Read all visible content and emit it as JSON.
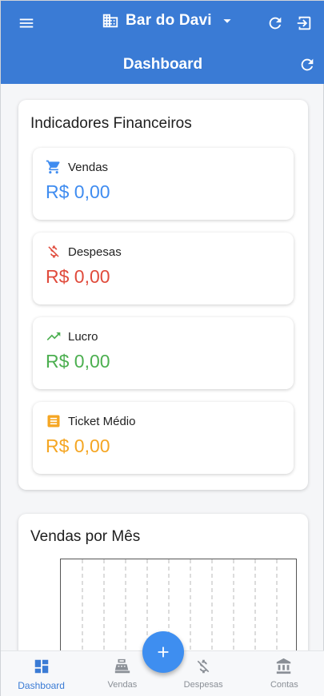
{
  "header": {
    "store_name": "Bar do Davi",
    "title": "Dashboard"
  },
  "indicators": {
    "title": "Indicadores Financeiros",
    "items": [
      {
        "label": "Vendas",
        "value": "R$ 0,00",
        "color": "#3f8cf0",
        "icon": "cart-icon"
      },
      {
        "label": "Despesas",
        "value": "R$ 0,00",
        "color": "#e04b3c",
        "icon": "money-off-icon"
      },
      {
        "label": "Lucro",
        "value": "R$ 0,00",
        "color": "#4caf50",
        "icon": "trending-up-icon"
      },
      {
        "label": "Ticket Médio",
        "value": "R$ 0,00",
        "color": "#f5a623",
        "icon": "receipt-icon"
      }
    ]
  },
  "sales_chart": {
    "title": "Vendas por Mês"
  },
  "bottom_nav": {
    "items": [
      {
        "label": "Dashboard",
        "icon": "dashboard-icon",
        "active": true
      },
      {
        "label": "Vendas",
        "icon": "cash-register-icon",
        "active": false
      },
      {
        "label": "Despesas",
        "icon": "money-off-icon",
        "active": false
      },
      {
        "label": "Contas",
        "icon": "bank-icon",
        "active": false
      }
    ]
  },
  "colors": {
    "primary": "#3a7bd5",
    "fab": "#3e8ef0"
  }
}
